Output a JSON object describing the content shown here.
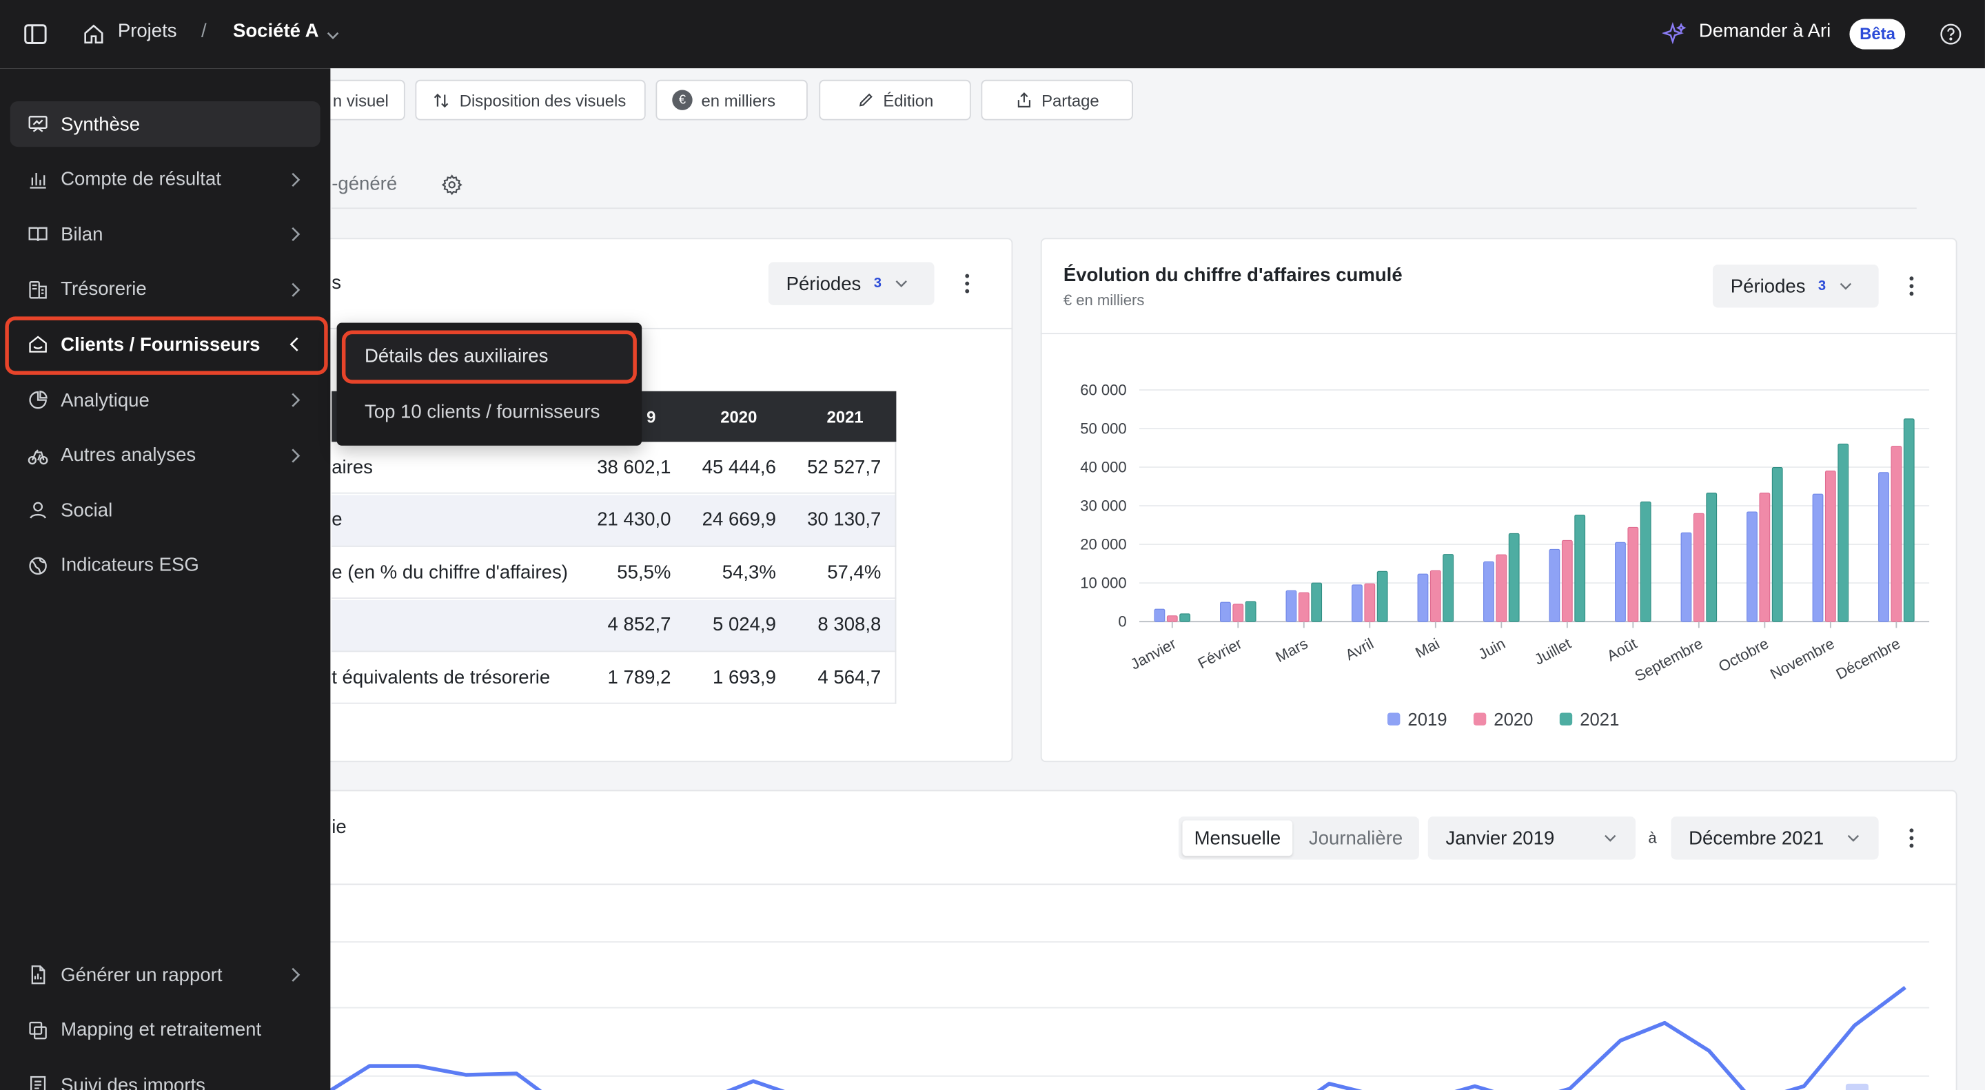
{
  "topbar": {
    "projects": "Projets",
    "separator": "/",
    "company": "Société A",
    "ask_ari": "Demander à Ari",
    "beta": "Bêta"
  },
  "toolbar": {
    "add_visual_partial": "n visuel",
    "layout": "Disposition des visuels",
    "units": "en milliers",
    "edit": "Édition",
    "share": "Partage"
  },
  "tab_partial": "-généré",
  "left_card": {
    "title_partial": "s",
    "periods_label": "Périodes",
    "periods_count": "3",
    "table": {
      "headers": [
        "9",
        "2020",
        "2021"
      ],
      "rows": [
        {
          "label": "aires",
          "v": [
            "38 602,1",
            "45 444,6",
            "52 527,7"
          ]
        },
        {
          "label": "e",
          "v": [
            "21 430,0",
            "24 669,9",
            "30 130,7"
          ]
        },
        {
          "label": "e (en % du chiffre d'affaires)",
          "v": [
            "55,5%",
            "54,3%",
            "57,4%"
          ]
        },
        {
          "label": "",
          "v": [
            "4 852,7",
            "5 024,9",
            "8 308,8"
          ]
        },
        {
          "label": "t équivalents de trésorerie",
          "v": [
            "1 789,2",
            "1 693,9",
            "4 564,7"
          ]
        }
      ]
    }
  },
  "right_card": {
    "title": "Évolution du chiffre d'affaires cumulé",
    "subtitle": "€ en milliers",
    "periods_label": "Périodes",
    "periods_count": "3"
  },
  "chart_data": {
    "type": "bar",
    "title": "Évolution du chiffre d'affaires cumulé",
    "subtitle": "€ en milliers",
    "categories": [
      "Janvier",
      "Février",
      "Mars",
      "Avril",
      "Mai",
      "Juin",
      "Juillet",
      "Août",
      "Septembre",
      "Octobre",
      "Novembre",
      "Décembre"
    ],
    "series": [
      {
        "name": "2019",
        "color": "#8ea2f5",
        "values": [
          3200,
          5000,
          8000,
          9500,
          12300,
          15500,
          18700,
          20500,
          23000,
          28400,
          33000,
          38600
        ]
      },
      {
        "name": "2020",
        "color": "#f08aa8",
        "values": [
          1500,
          4500,
          7500,
          9800,
          13200,
          17300,
          21000,
          24400,
          28000,
          33300,
          39000,
          45400
        ]
      },
      {
        "name": "2021",
        "color": "#4eada2",
        "values": [
          2000,
          5200,
          10000,
          13000,
          17400,
          22800,
          27600,
          31000,
          33300,
          39900,
          46000,
          52500
        ]
      }
    ],
    "ylim": [
      0,
      60000
    ],
    "yticks": [
      "0",
      "10 000",
      "20 000",
      "30 000",
      "40 000",
      "50 000",
      "60 000"
    ],
    "grid": true,
    "legend": "bottom"
  },
  "bottom_card": {
    "title_partial": "ie",
    "monthly": "Mensuelle",
    "daily": "Journalière",
    "from": "Janvier 2019",
    "to_word": "à",
    "to": "Décembre 2021"
  },
  "sidebar": {
    "items": [
      {
        "label": "Synthèse"
      },
      {
        "label": "Compte de résultat"
      },
      {
        "label": "Bilan"
      },
      {
        "label": "Trésorerie"
      },
      {
        "label": "Clients / Fournisseurs"
      },
      {
        "label": "Analytique"
      },
      {
        "label": "Autres analyses"
      },
      {
        "label": "Social"
      },
      {
        "label": "Indicateurs ESG"
      }
    ],
    "bottom": [
      {
        "label": "Générer un rapport"
      },
      {
        "label": "Mapping et retraitement"
      },
      {
        "label": "Suivi des imports"
      }
    ]
  },
  "submenu": {
    "items": [
      "Détails des auxiliaires",
      "Top 10 clients / fournisseurs"
    ]
  }
}
